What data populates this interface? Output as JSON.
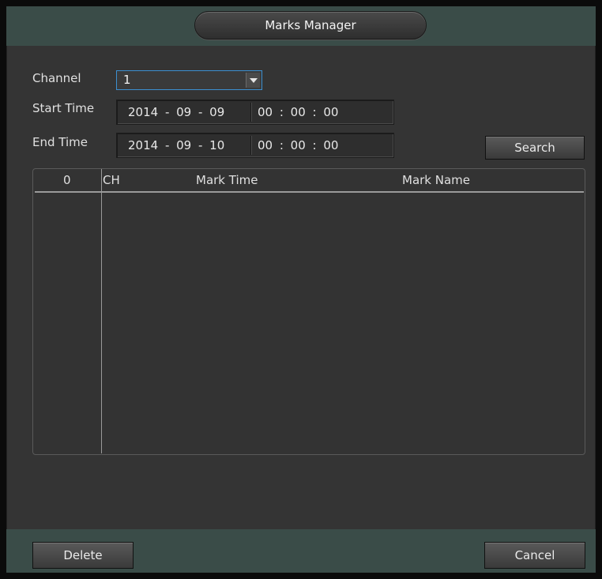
{
  "window": {
    "title": "Marks Manager"
  },
  "form": {
    "channel_label": "Channel",
    "channel_value": "1",
    "start_label": "Start Time",
    "start_date": "2014 - 09 - 09",
    "start_time": "00 : 00 : 00",
    "end_label": "End Time",
    "end_date": "2014 - 09 - 10",
    "end_time": "00 : 00 : 00",
    "search_label": "Search"
  },
  "table": {
    "count": "0",
    "columns": [
      "CH",
      "Mark Time",
      "Mark Name"
    ],
    "rows": []
  },
  "footer": {
    "delete_label": "Delete",
    "cancel_label": "Cancel"
  },
  "colors": {
    "accent": "#3c8fd0",
    "titlebar": "#3a4c48",
    "panel": "#343434"
  },
  "icons": {
    "dropdown": "chevron-down-icon"
  }
}
